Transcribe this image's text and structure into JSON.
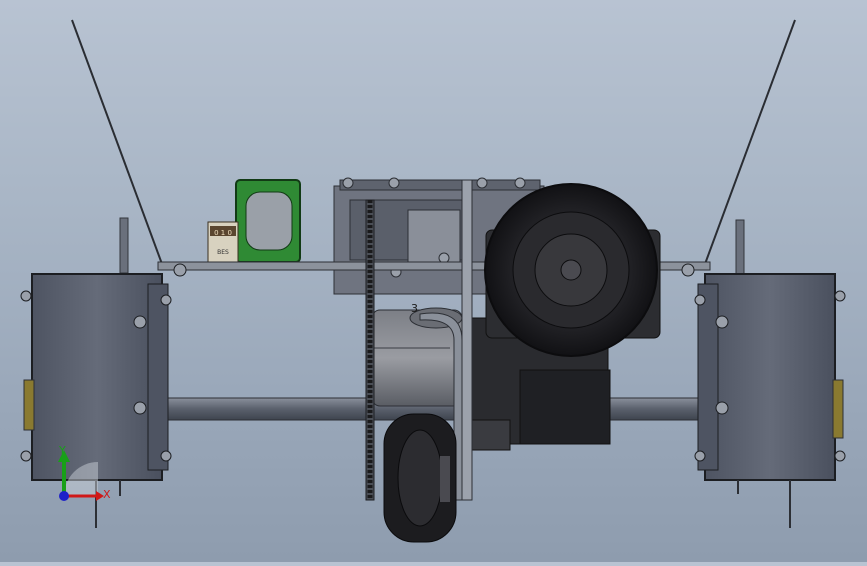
{
  "viewport": {
    "background_top": "#b8c3d2",
    "background_bottom": "#8e9cae"
  },
  "model": {
    "callout_number": "3",
    "board_text_top": "0 1 0",
    "board_text_bottom": "BES"
  },
  "triad": {
    "y_label": "Y",
    "x_label": "X",
    "x_color": "#d01818",
    "y_color": "#18a018",
    "z_color": "#1e22c8"
  },
  "colors": {
    "side_box": "#5c6270",
    "green_part": "#2f8a34",
    "wheel": "#1c1c1e",
    "frame": "#707682"
  }
}
